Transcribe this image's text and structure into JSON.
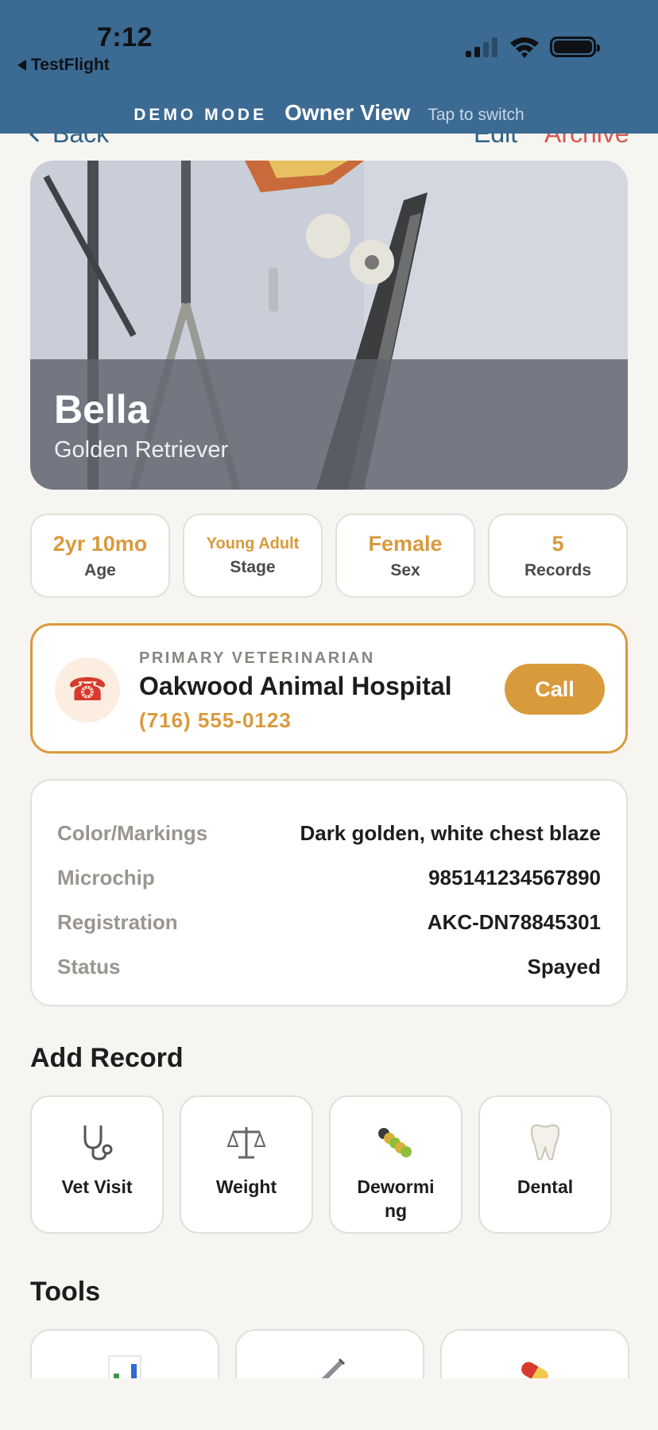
{
  "status_bar": {
    "time": "7:12",
    "back_app": "TestFlight",
    "signal_bars": 2,
    "icons": [
      "cellular-signal-icon",
      "wifi-icon",
      "battery-icon"
    ]
  },
  "demo_banner": {
    "mode": "DEMO MODE",
    "view": "Owner View",
    "hint": "Tap to switch"
  },
  "nav": {
    "back": "Back",
    "edit": "Edit",
    "archive": "Archive"
  },
  "pet": {
    "name": "Bella",
    "breed": "Golden Retriever"
  },
  "stats": [
    {
      "value": "2yr 10mo",
      "label": "Age"
    },
    {
      "value": "Young Adult",
      "label": "Stage"
    },
    {
      "value": "Female",
      "label": "Sex"
    },
    {
      "value": "5",
      "label": "Records"
    }
  ],
  "vet": {
    "kicker": "PRIMARY VETERINARIAN",
    "name": "Oakwood Animal Hospital",
    "phone": "(716) 555-0123",
    "call": "Call",
    "icon": "telephone-icon"
  },
  "details": [
    {
      "key": "Color/Markings",
      "value": "Dark golden, white chest blaze"
    },
    {
      "key": "Microchip",
      "value": "985141234567890"
    },
    {
      "key": "Registration",
      "value": "AKC-DN78845301"
    },
    {
      "key": "Status",
      "value": "Spayed"
    }
  ],
  "add_record": {
    "title": "Add Record",
    "tiles": [
      {
        "label": "Vet Visit",
        "icon": "stethoscope-icon"
      },
      {
        "label": "Weight",
        "icon": "scale-icon"
      },
      {
        "label": "Deworming",
        "icon": "worm-icon"
      },
      {
        "label": "Dental",
        "icon": "tooth-icon"
      }
    ]
  },
  "tools": {
    "title": "Tools",
    "tiles": [
      {
        "icon": "chart-icon"
      },
      {
        "icon": "syringe-icon"
      },
      {
        "icon": "pill-icon"
      }
    ]
  },
  "colors": {
    "banner": "#3b6a93",
    "accent": "#d99a3c",
    "link": "#2f6288",
    "destructive": "#d7574e",
    "background": "#f7f5f1"
  }
}
